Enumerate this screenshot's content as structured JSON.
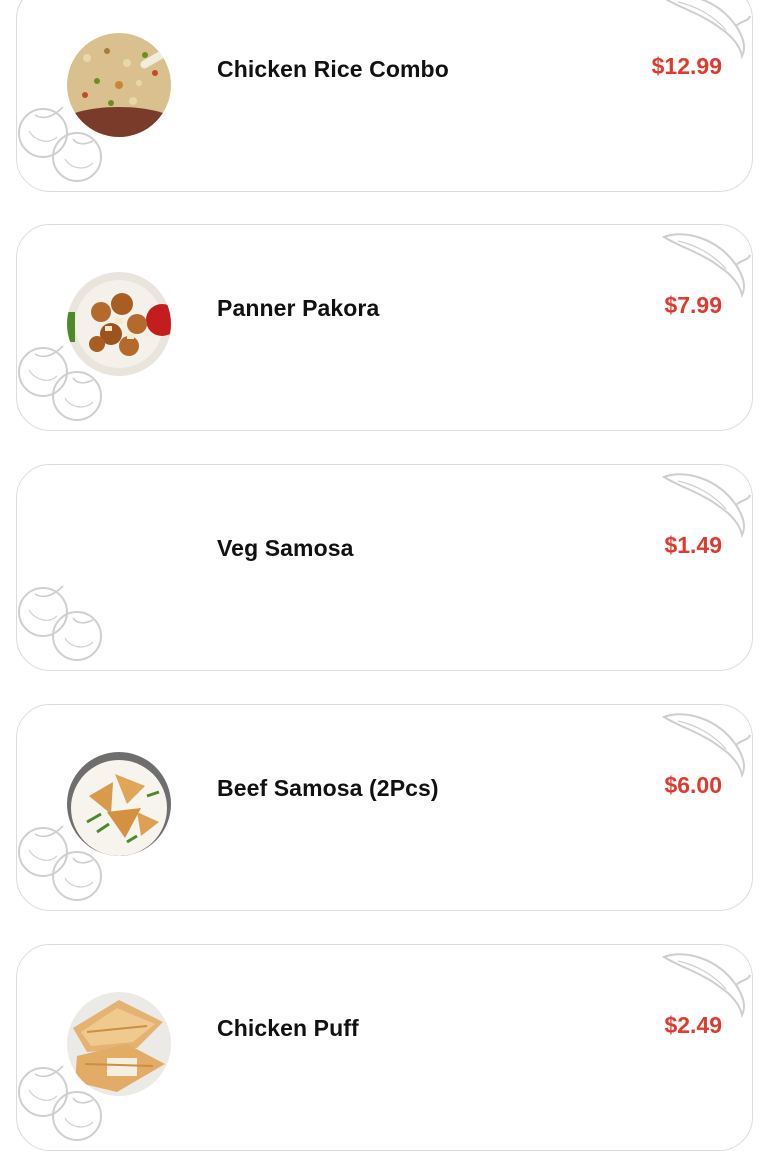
{
  "colors": {
    "price": "#e03a2e",
    "name": "#111111",
    "card_border": "#dcdcdc",
    "doodle": "#cfcfcf"
  },
  "menu": {
    "items": [
      {
        "name": "Chicken Rice Combo",
        "price": "$12.99",
        "image_icon": "fried-rice-photo"
      },
      {
        "name": "Panner Pakora",
        "price": "$7.99",
        "image_icon": "paneer-pakora-photo"
      },
      {
        "name": "Veg Samosa",
        "price": "$1.49",
        "image_icon": ""
      },
      {
        "name": "Beef Samosa (2Pcs)",
        "price": "$6.00",
        "image_icon": "samosa-photo"
      },
      {
        "name": "Chicken Puff",
        "price": "$2.49",
        "image_icon": "puff-pastry-photo"
      }
    ]
  }
}
